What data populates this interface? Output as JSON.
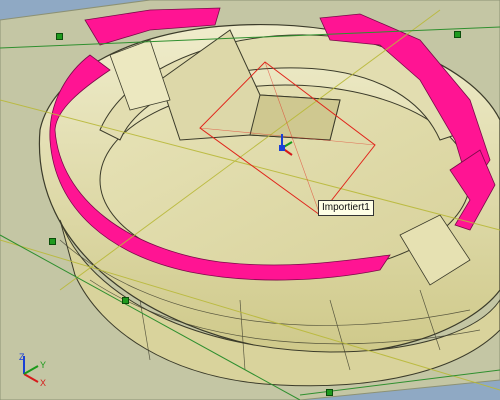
{
  "tooltip": {
    "label": "Importiert1"
  },
  "colors": {
    "background": "#8fa9c4",
    "model_face": "#e9e6b4",
    "model_shadow": "#c9c27a",
    "edge": "#3b3b2a",
    "highlight": "#ff1493",
    "sketch_plane": "#e0251b",
    "reference_line": "#b9b93a",
    "handle": "#1f9a1f"
  },
  "icons": {
    "origin_triad": "xyz-triad-icon",
    "corner_triad": "xyz-triad-icon",
    "handles": "green-square-handle-icon"
  },
  "triad_axes": {
    "x": "X",
    "y": "Y",
    "z": "Z"
  }
}
